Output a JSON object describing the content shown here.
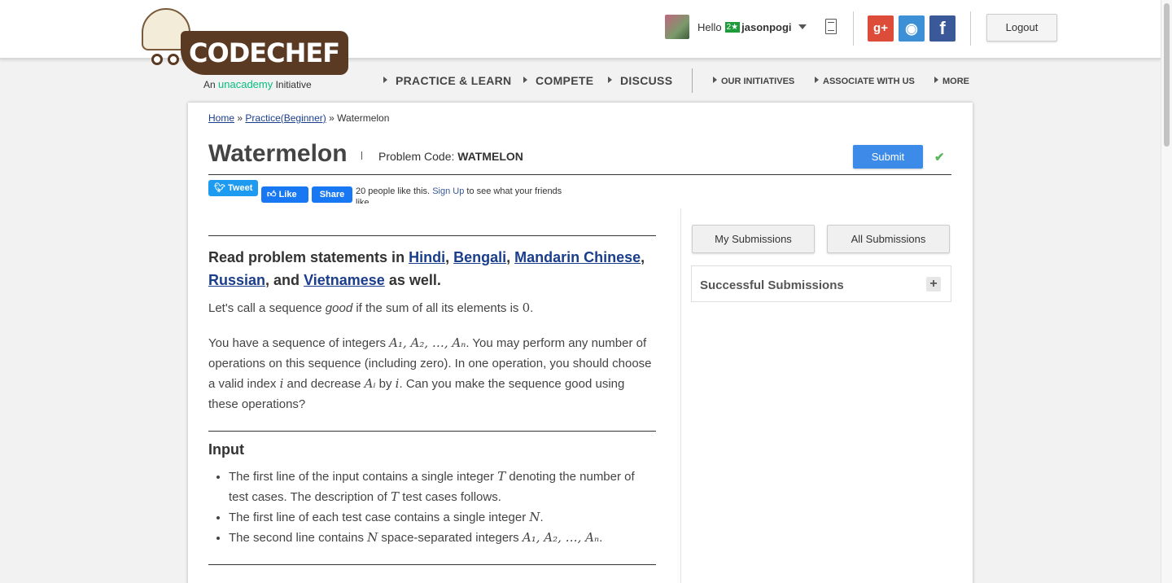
{
  "header": {
    "logo_text": "CODECHEF",
    "logo_tag_prefix": "An",
    "logo_tag_brand": "unacademy",
    "logo_tag_suffix": "Initiative",
    "hello": "Hello",
    "rating_stars": "2★",
    "username": "jasonpogi",
    "logout_label": "Logout",
    "social": {
      "gplus": "g+",
      "github": "◉",
      "facebook": "f"
    }
  },
  "nav": {
    "primary": [
      "PRACTICE & LEARN",
      "COMPETE",
      "DISCUSS"
    ],
    "secondary": [
      "OUR INITIATIVES",
      "ASSOCIATE WITH US",
      "MORE"
    ]
  },
  "breadcrumb": {
    "home": "Home",
    "sep1": "»",
    "practice": "Practice(Beginner)",
    "sep2": "»",
    "current": "Watermelon"
  },
  "problem": {
    "title": "Watermelon",
    "code_label": "Problem Code: ",
    "code": "WATMELON",
    "submit_label": "Submit",
    "check": "✔"
  },
  "share": {
    "tweet": "Tweet",
    "like": "Like",
    "share": "Share",
    "likes_text": "20 people like this.",
    "signup": "Sign Up",
    "signup_suffix": "to see what your friends like."
  },
  "statement": {
    "lang_prefix": "Read problem statements in",
    "lang_hindi": "Hindi",
    "lang_bengali": "Bengali",
    "lang_mandarin": "Mandarin Chinese",
    "lang_russian": "Russian",
    "lang_and": ", and",
    "lang_vietnamese": "Vietnamese",
    "lang_suffix": "as well.",
    "p1_a": "Let's call a sequence",
    "p1_good": "good",
    "p1_b": "if the sum of all its elements is",
    "p1_zero": "0",
    "p1_end": ".",
    "p2_a": "You have a sequence of integers",
    "seq": "A₁, A₂, …, Aₙ",
    "p2_b": ". You may perform any number of operations on this sequence (including zero). In one operation, you should choose a valid index",
    "var_i": "i",
    "p2_c": "and decrease",
    "var_ai": "Aᵢ",
    "p2_d": "by",
    "p2_e": ". Can you make the sequence good using these operations?",
    "input_heading": "Input",
    "in1_a": "The first line of the input contains a single integer",
    "var_t": "T",
    "in1_b": "denoting the number of test cases. The description of",
    "in1_c": "test cases follows.",
    "in2_a": "The first line of each test case contains a single integer",
    "var_n": "N",
    "in2_b": ".",
    "in3_a": "The second line contains",
    "in3_b": "space-separated integers",
    "in3_c": "."
  },
  "sidebar": {
    "my_submissions": "My Submissions",
    "all_submissions": "All Submissions",
    "successful_submissions": "Successful Submissions",
    "expand": "+"
  }
}
